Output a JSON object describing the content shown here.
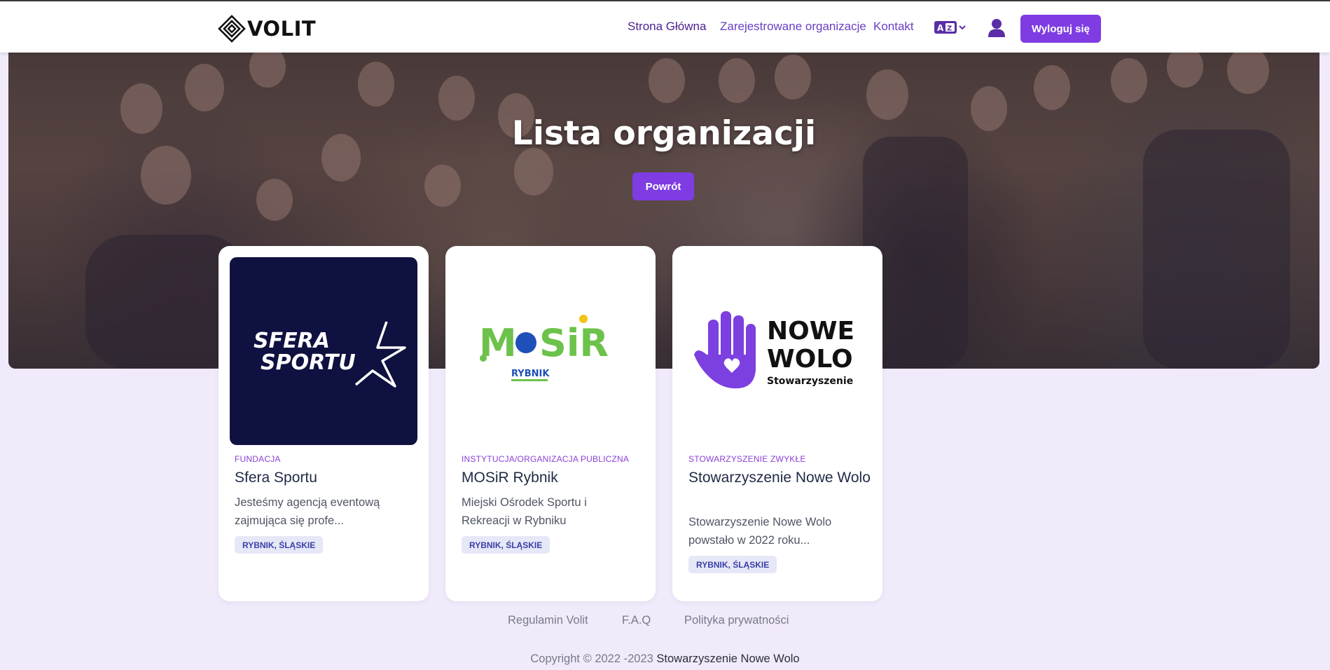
{
  "header": {
    "logo_text": "VOLIT",
    "nav": [
      {
        "label": "Strona Główna"
      },
      {
        "label": "Zarejestrowane organizacje"
      },
      {
        "label": "Kontakt"
      }
    ],
    "language_icon": "translate-icon",
    "user_icon": "user-icon",
    "logout_label": "Wyloguj się",
    "accent_color": "#7f3ce2"
  },
  "hero": {
    "title": "Lista organizacji",
    "back_label": "Powrót"
  },
  "cards": [
    {
      "type": "FUNDACJA",
      "title": "Sfera Sportu",
      "description": "Jesteśmy agencją eventową zajmująca się profe...",
      "location": "RYBNIK, ŚLĄSKIE",
      "logo_text_1": "SFERA",
      "logo_text_2": "SPORTU"
    },
    {
      "type": "INSTYTUCJA/ORGANIZACJA PUBLICZNA",
      "title": "MOSiR Rybnik",
      "description": "Miejski Ośrodek Sportu i Rekreacji w Rybniku",
      "location": "RYBNIK, ŚLĄSKIE",
      "logo_text_1": "MOSiR",
      "logo_text_2": "RYBNIK"
    },
    {
      "type": "STOWARZYSZENIE ZWYKŁE",
      "title": "Stowarzyszenie Nowe Wolo",
      "description": "Stowarzyszenie Nowe Wolo powstało w 2022 roku...",
      "location": "RYBNIK, ŚLĄSKIE",
      "logo_text_1": "NOWE",
      "logo_text_2": "WOLO",
      "logo_text_3": "Stowarzyszenie"
    }
  ],
  "footer": {
    "links": [
      "Regulamin Volit",
      "F.A.Q",
      "Polityka prywatności"
    ],
    "copyright": "Copyright © 2022 -2023",
    "copyright_owner": "Stowarzyszenie Nowe Wolo"
  }
}
